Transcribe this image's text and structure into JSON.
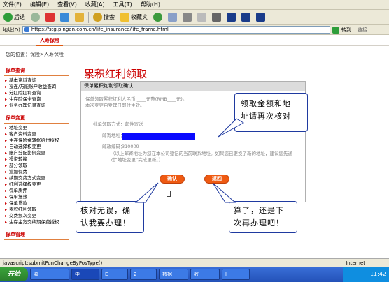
{
  "menu": [
    "文件(F)",
    "编辑(E)",
    "查看(V)",
    "收藏(A)",
    "工具(T)",
    "帮助(H)"
  ],
  "toolbar": {
    "back": "后退",
    "search": "搜索",
    "favorites": "收藏夹"
  },
  "address": {
    "label": "地址(D)",
    "url": "https://stg.pingan.com.cn/life_insurance/life_frame.html",
    "go": "转到",
    "links": "链接"
  },
  "brand_tab": "人寿保险",
  "breadcrumb": "您的位置：保险>人寿保险",
  "sidebar": {
    "sections": [
      {
        "title": "保单查询",
        "items": [
          "基本资料查询",
          "投连/万能账户收益查询",
          "分红险红利查询",
          "生存险保全查询",
          "业务办理记录查询"
        ]
      },
      {
        "title": "保单变更",
        "items": [
          "地址变更",
          "客户资料变更",
          "生存保险金转帐给付授权",
          "自动选择权变更",
          "账户分配比例变更",
          "投资转换",
          "部分领取",
          "追加保费",
          "续期交费方式变更",
          "红利选择权变更",
          "保单质押",
          "保单复效",
          "保单贷款",
          "累积红利领取",
          "交费频次变更",
          "生存金宽交续期保费授权"
        ]
      },
      {
        "title": "保单管理",
        "items": []
      }
    ]
  },
  "page_title": "累积红利领取",
  "form": {
    "header": "保单累积红利领取确认",
    "intro1": "保单领取累积红利人民币:____元整(RMB____元)。",
    "intro2": "本次变更自受理日即时生效。",
    "receive_method": "批单领取方式：邮件寄送",
    "mail_address_label": "邮寄地址：",
    "postcode_label": "邮政编码：",
    "postcode": "310009",
    "note": "（以上邮寄地址为您在本公司登记的当前联系地址。如果您已更换了新的地址，建议您先通过“地址变更”完成更新。）",
    "ok": "确认",
    "back": "返回"
  },
  "callouts": {
    "top_right": [
      "领取金额和地",
      "址请再次核对"
    ],
    "bottom_left": [
      "核对无误，确",
      "认我要办理！"
    ],
    "bottom_right": [
      "算了，还是下",
      "次再办理吧！"
    ]
  },
  "status": {
    "text": "javascript:submitFunChangeByPosType()",
    "zone": "Internet"
  },
  "taskbar": {
    "start": "开始",
    "tasks": [
      "收",
      "中",
      "E",
      "2",
      "数据",
      "收",
      "l"
    ],
    "clock": "11:42"
  }
}
